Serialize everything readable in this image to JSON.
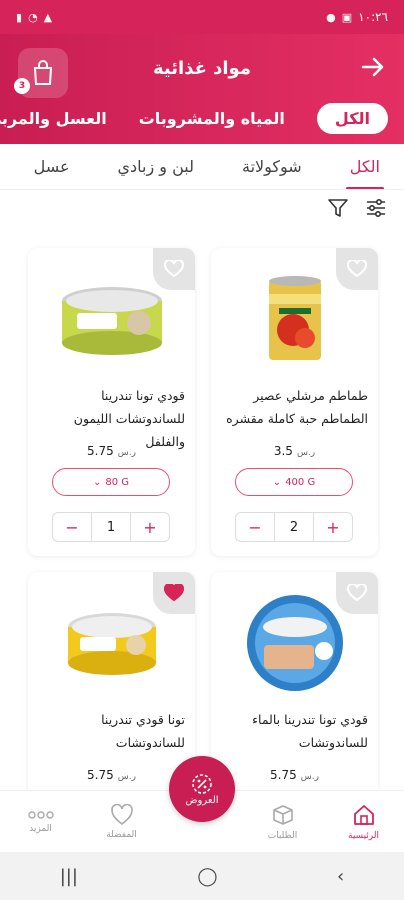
{
  "status_bar": {
    "time": "١٠:٢٦",
    "left_icons": [
      "signal-icon",
      "wifi-icon",
      "battery-icon"
    ],
    "right_icons": [
      "alarm-icon",
      "image-icon"
    ]
  },
  "header": {
    "title": "مواد غذائية",
    "cart_count": "3",
    "categories": [
      {
        "label": "الكل",
        "active": true
      },
      {
        "label": "المياه والمشروبات",
        "active": false
      },
      {
        "label": "العسل والمربى",
        "active": false
      }
    ]
  },
  "subtabs": [
    {
      "label": "الكل",
      "active": true
    },
    {
      "label": "شوكولاتة",
      "active": false
    },
    {
      "label": "لبن و زبادي",
      "active": false
    },
    {
      "label": "عسل",
      "active": false
    }
  ],
  "products": [
    {
      "name_line1": "طماطم مرشلي عصير",
      "name_line2": "الطماطم حبة كاملة مقشره",
      "price": "3.5",
      "currency": "ر.س",
      "size": "400 G",
      "qty": "2",
      "favorite": false
    },
    {
      "name_line1": "قودي تونا تندرينا",
      "name_line2": "للساندوتشات الليمون والفلفل",
      "price": "5.75",
      "currency": "ر.س",
      "size": "80 G",
      "qty": "1",
      "favorite": false
    },
    {
      "name_line1": "قودي تونا تندرينا بالماء",
      "name_line2": "للساندوتشات",
      "price": "5.75",
      "currency": "ر.س",
      "size": "",
      "qty": "",
      "favorite": false
    },
    {
      "name_line1": "تونا قودي تندرينا",
      "name_line2": "للساندوتشات",
      "price": "5.75",
      "currency": "ر.س",
      "size": "",
      "qty": "",
      "favorite": true
    }
  ],
  "bottom_nav": [
    {
      "label": "الرئيسية",
      "icon": "home-icon",
      "active": true
    },
    {
      "label": "الطلبات",
      "icon": "box-icon",
      "active": false
    },
    {
      "label": "المفضلة",
      "icon": "heart-icon",
      "active": false
    },
    {
      "label": "المزيد",
      "icon": "more-icon",
      "active": false
    }
  ],
  "offers_label": "العروض",
  "colors": {
    "primary": "#d6245a",
    "accent": "#e9506f"
  }
}
